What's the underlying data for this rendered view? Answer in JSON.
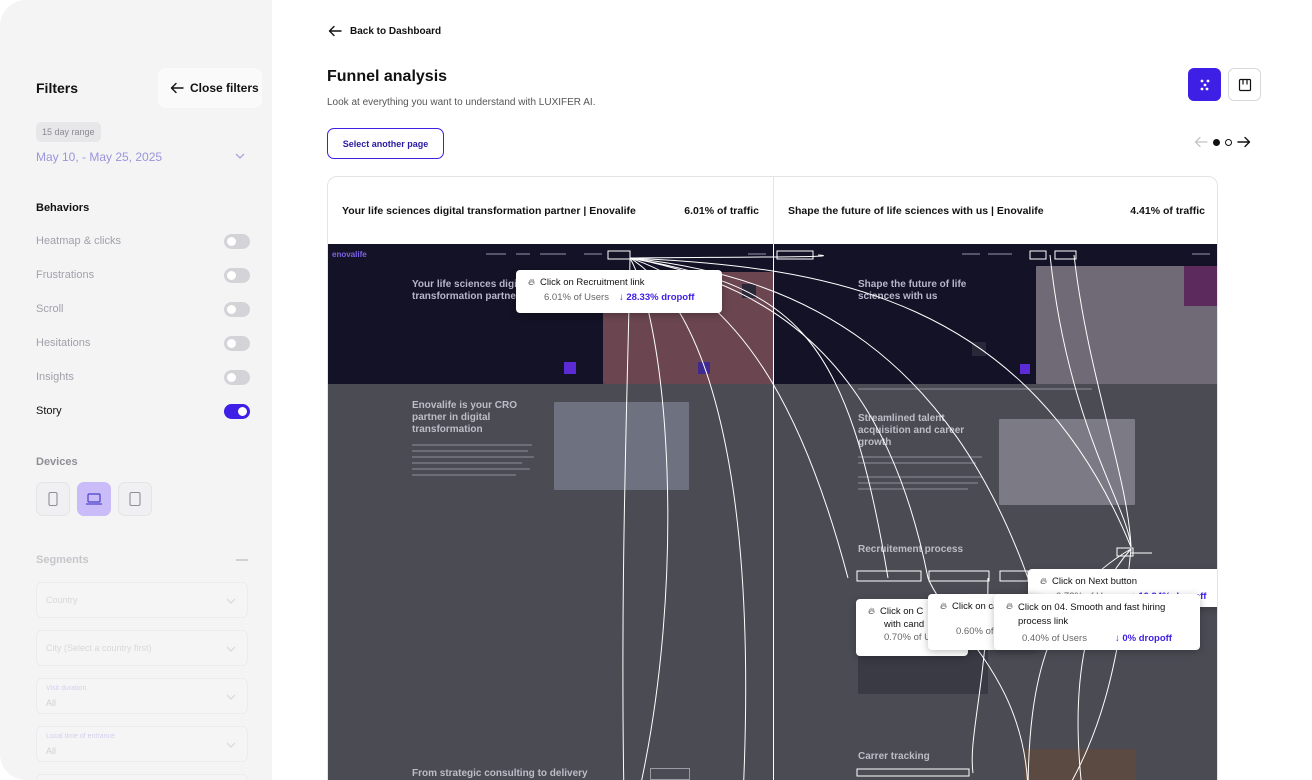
{
  "sidebar": {
    "title": "Filters",
    "close_label": "Close filters",
    "range_badge": "15 day range",
    "date_range": "May 10, - May 25, 2025",
    "behaviors_title": "Behaviors",
    "behaviors": [
      {
        "label": "Heatmap & clicks",
        "on": false
      },
      {
        "label": "Frustrations",
        "on": false
      },
      {
        "label": "Scroll",
        "on": false
      },
      {
        "label": "Hesitations",
        "on": false
      },
      {
        "label": "Insights",
        "on": false
      },
      {
        "label": "Story",
        "on": true
      }
    ],
    "devices_title": "Devices",
    "devices": [
      {
        "icon": "mobile-icon",
        "selected": false
      },
      {
        "icon": "laptop-icon",
        "selected": true
      },
      {
        "icon": "tablet-icon",
        "selected": false
      }
    ],
    "segments_title": "Segments",
    "segments": [
      {
        "placeholder": "Country"
      },
      {
        "placeholder": "City (Select a country first)"
      },
      {
        "label": "Visit duration",
        "value": "All"
      },
      {
        "label": "Local time of entrance",
        "value": "All"
      }
    ]
  },
  "header": {
    "back_label": "Back to Dashboard",
    "title": "Funnel analysis",
    "subtitle": "Look at everything you want to understand with LUXIFER AI.",
    "select_page_label": "Select another page"
  },
  "accent_color": "#3d1fe6",
  "pages": [
    {
      "title": "Your life sciences digital transformation partner | Enovalife",
      "traffic": "6.01% of traffic",
      "logo_text": "enovalife",
      "hero_text": "Your life sciences digital transformation partner",
      "section_text": "Enovalife is your CRO partner in digital transformation",
      "footer_text": "From strategic consulting to delivery"
    },
    {
      "title": "Shape the future of life sciences with us | Enovalife",
      "traffic": "4.41% of traffic",
      "hero_text": "Shape the future of life sciences with us",
      "section_text": "Streamlined talent acquisition and career growth",
      "process_text": "Recruitement process",
      "tracking_text": "Carrer tracking"
    }
  ],
  "tooltips": [
    {
      "title": "Click on Recruitment link",
      "users": "6.01% of Users",
      "dropoff": "28.33% dropoff"
    },
    {
      "title": "Click on Next button",
      "users": "0.73% of Users",
      "dropoff": "10.94% dropoff"
    },
    {
      "title": "Click on 04. Smooth and fast hiring process link",
      "users": "0.40% of Users",
      "dropoff": "0% dropoff"
    },
    {
      "title": "Click on candidat",
      "users": "0.60% of Users"
    },
    {
      "title": "Click on C",
      "title2": "with cand",
      "users": "0.70% of Users"
    }
  ]
}
